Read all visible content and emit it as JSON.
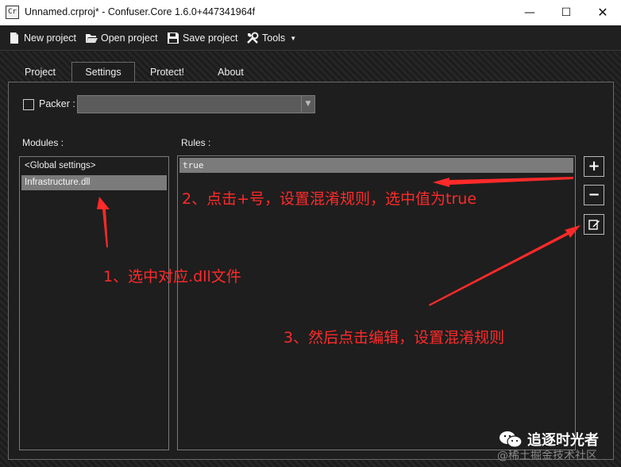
{
  "window": {
    "app_icon_text": "Cr",
    "title": "Unnamed.crproj* - Confuser.Core 1.6.0+447341964f",
    "minimize": "—",
    "maximize": "☐",
    "close": "✕"
  },
  "toolbar": {
    "new_project": "New project",
    "open_project": "Open project",
    "save_project": "Save project",
    "tools": "Tools"
  },
  "tabs": [
    {
      "label": "Project"
    },
    {
      "label": "Settings"
    },
    {
      "label": "Protect!"
    },
    {
      "label": "About"
    }
  ],
  "settings": {
    "packer_label": "Packer :",
    "packer_value": "",
    "modules_label": "Modules :",
    "rules_label": "Rules :",
    "modules": [
      {
        "label": "<Global settings>"
      },
      {
        "label": "Infrastructure.dll"
      }
    ],
    "rules": [
      {
        "label": "true"
      }
    ],
    "add_rule": "+",
    "remove_rule": "−"
  },
  "annotations": {
    "step1": "1、选中对应.dll文件",
    "step2": "2、点击+号，设置混淆规则，选中值为true",
    "step3": "3、然后点击编辑，设置混淆规则",
    "color": "#ff2a2a"
  },
  "watermark": {
    "account": "追逐时光者",
    "source": "@稀土掘金技术社区"
  }
}
